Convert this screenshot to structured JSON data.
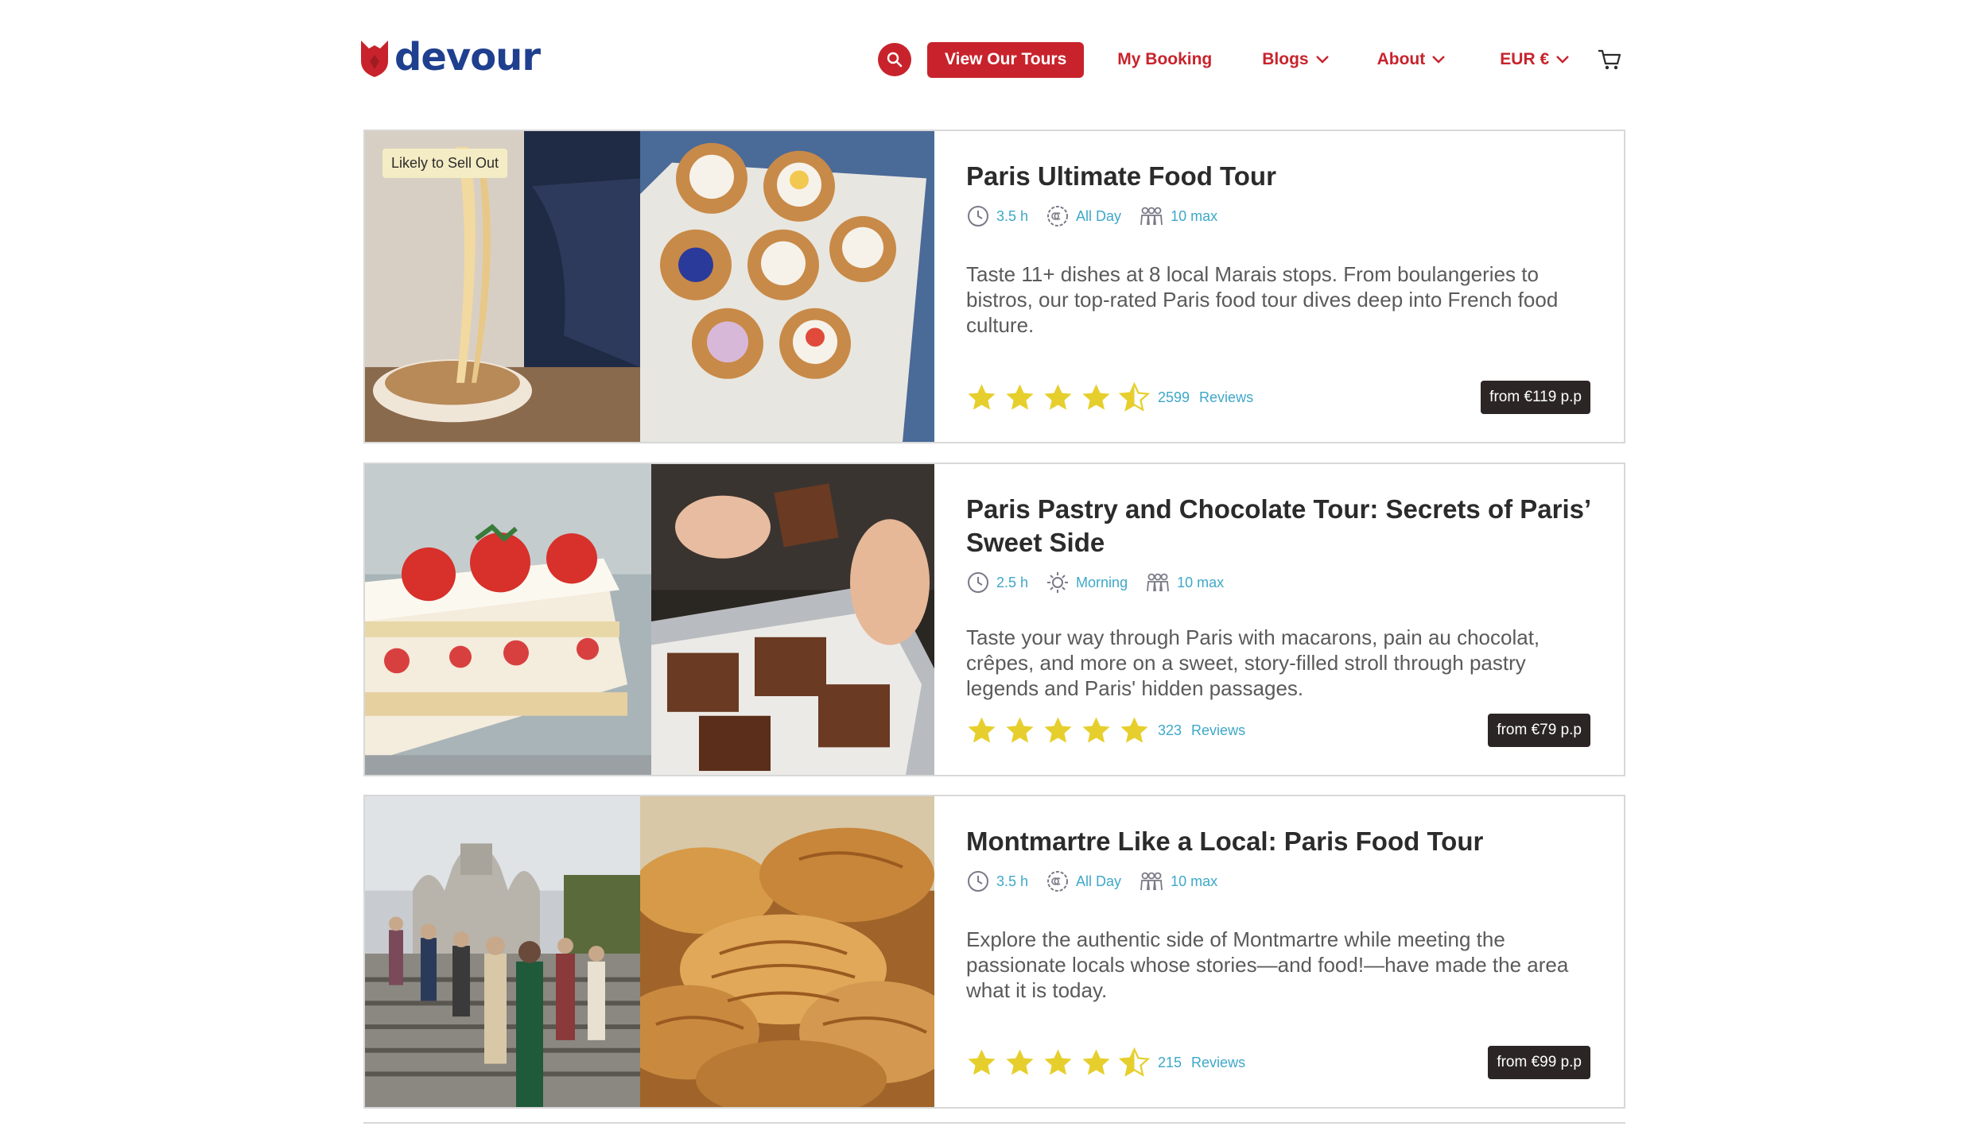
{
  "brand": {
    "name": "devour",
    "logo_color": "#1f3f8f",
    "accent": "#c8232c"
  },
  "nav": {
    "search_icon": "search-icon",
    "tours_label": "View Our Tours",
    "booking_label": "My Booking",
    "blogs_label": "Blogs",
    "about_label": "About",
    "currency_label": "EUR €",
    "cart_icon": "cart-icon"
  },
  "tours": [
    {
      "badge": "Likely to Sell Out",
      "title": "Paris Ultimate Food Tour",
      "duration": "3.5 h",
      "time_of_day": "All Day",
      "group": "10 max",
      "description": "Taste 11+ dishes at 8 local Marais stops. From boulangeries to bistros, our top-rated Paris food tour dives deep into French food culture.",
      "rating": 4.5,
      "review_count": "2599",
      "reviews_label": "Reviews",
      "price": "from €119 p.p"
    },
    {
      "title": "Paris Pastry and Chocolate Tour: Secrets of Paris’ Sweet Side",
      "duration": "2.5 h",
      "time_of_day": "Morning",
      "group": "10 max",
      "description": "Taste your way through Paris with macarons, pain au chocolat, crêpes, and more on a sweet, story-filled stroll through pastry legends and Paris' hidden passages.",
      "rating": 5,
      "review_count": "323",
      "reviews_label": "Reviews",
      "price": "from €79 p.p"
    },
    {
      "title": "Montmartre Like a Local: Paris Food Tour",
      "duration": "3.5 h",
      "time_of_day": "All Day",
      "group": "10 max",
      "description": "Explore the authentic side of Montmartre while meeting the passionate locals whose stories—and food!—have made the area what it is today.",
      "rating": 4.5,
      "review_count": "215",
      "reviews_label": "Reviews",
      "price": "from €99 p.p"
    }
  ]
}
